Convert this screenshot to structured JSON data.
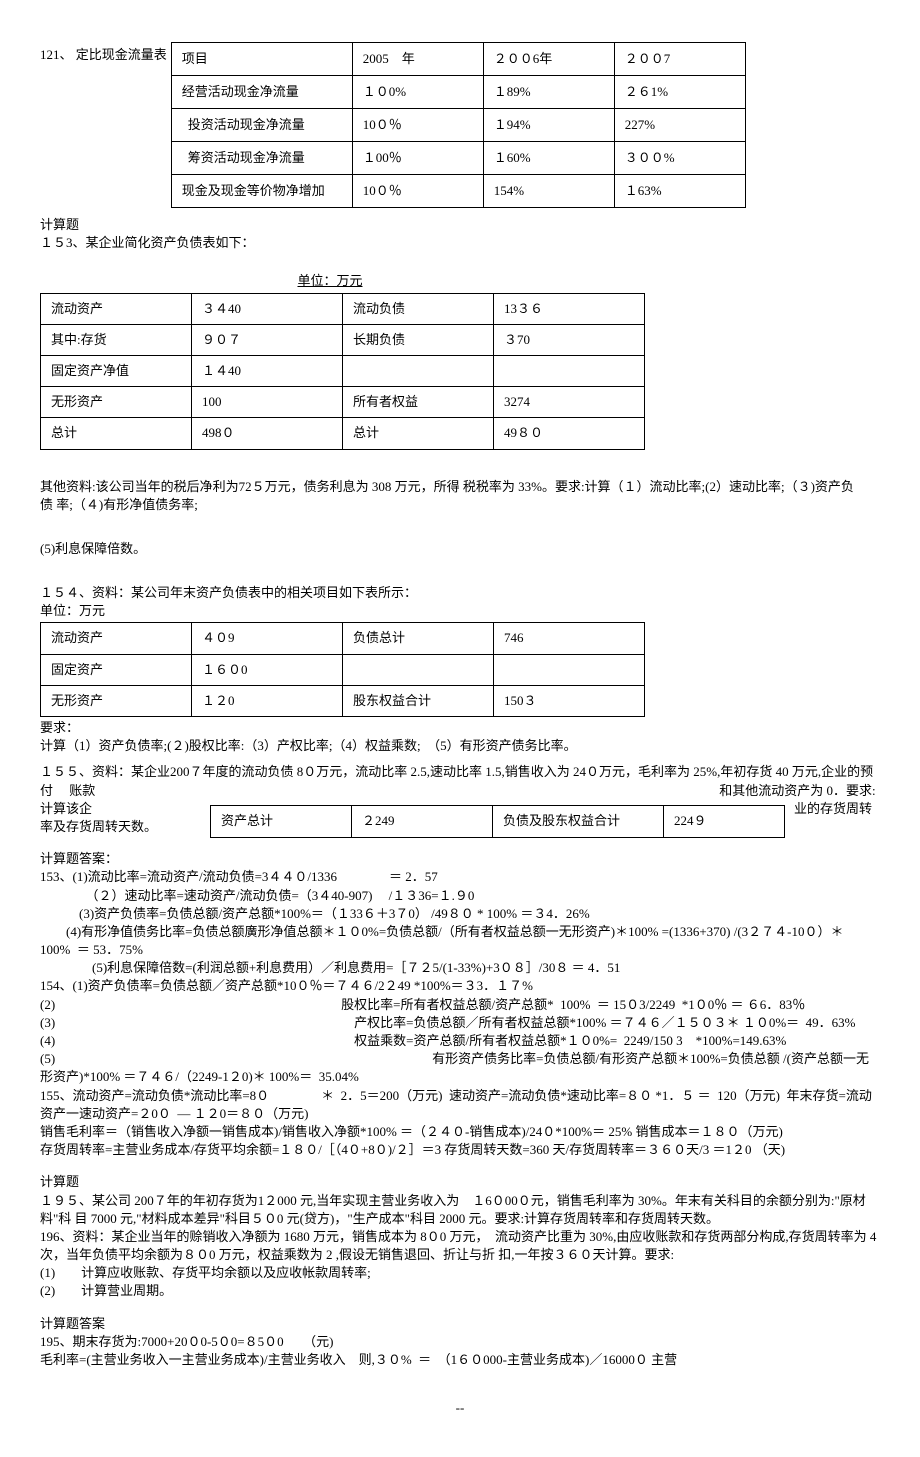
{
  "q121": {
    "heading": "121、 定比现金流量表",
    "table": {
      "headers": [
        "项目",
        "2005　年",
        "２００6年",
        "２００7"
      ],
      "rows": [
        [
          "经营活动现金净流量",
          "１０0%",
          "１89%",
          "２６1%"
        ],
        [
          "投资活动现金净流量",
          "10０％",
          "１94%",
          "227%"
        ],
        [
          "筹资活动现金净流量",
          "１00％",
          "１60%",
          "３００%"
        ],
        [
          "现金及现金等价物净增加",
          "10０％",
          "154%",
          "１63%"
        ]
      ]
    }
  },
  "calc_header": "计算题",
  "q153": {
    "heading": "１５3、某企业简化资产负债表如下：",
    "unit": "单位：万元",
    "table": [
      [
        "流动资产",
        "３４40",
        "流动负债",
        "13３６"
      ],
      [
        "其中:存货",
        "９０７",
        "长期负债",
        "３70"
      ],
      [
        "固定资产净值",
        "１４40",
        "",
        ""
      ],
      [
        "无形资产",
        "100",
        "所有者权益",
        "3274"
      ],
      [
        "总计",
        "498０",
        "总计",
        "49８０"
      ]
    ],
    "other": "其他资料:该公司当年的税后净利为72５万元，债务利息为 308 万元，所得 税税率为 33%。要求:计算（１）流动比率;(2）速动比率;（３)资产负债 率;（４)有形净值债务率;",
    "line5": "(5)利息保障倍数。"
  },
  "q154": {
    "heading": "１５４、资料：某公司年末资产负债表中的相关项目如下表所示：",
    "unit": "单位：万元",
    "table": [
      [
        "流动资产",
        "４０9",
        "负债总计",
        "746"
      ],
      [
        "固定资产",
        "１６０0",
        "",
        ""
      ],
      [
        "无形资产",
        "１２0",
        "股东权益合计",
        "150３"
      ]
    ],
    "req": "要求：",
    "req2": "计算（1）资产负债率;(２)股权比率:（3）产权比率;（4）权益乘数;　（5）有形资产债务比率。"
  },
  "q155": {
    "text_left": "１５５、资料：某企业200７年度的流动负债 8０万元，流动比率 2.5,速动比率 1.5,销售收入为 24０万元，毛利率为 25%,年初存货 40 万元,企业的预付　 账款　　　　　　　　　　　　　　　　　　　　　　　　　　　　　　　　　　　　　　　　　　　　　　　　和其他流动资产为 0．要求:计算该企　　　　　　　　　　　　　　　　　　　　　　　　　　　　　　　　　　　　　　　　　　　　　　　　　　　　　　业的存货周转率及存货周转天数。",
    "table_row": [
      "资产总计",
      "２249",
      "负债及股东权益合计",
      "224９"
    ]
  },
  "answers": {
    "heading": "计算题答案：",
    "a153_1": "153、(1)流动比率=流动资产/流动负债=3４４０/1336　　　　＝ 2．57",
    "a153_2": "　　　　（２）速动比率=速动资产/流动负债=（3４40-907)　 /１３36=１.９0",
    "a153_3": "　　　(3)资产负债率=负债总额/资产总额*100%＝（１33６＋3７0） /49８０ * 100% ＝３4．26%",
    "a153_4": "　　(4)有形净值债务比率=负债总额廣形净值总额＊１０0%=负债总额/（所有者权益总额一无形资产)＊100% =(1336+370) /(3２７４-10０）＊100%  ＝ 53．75%",
    "a153_5": "　　　　(5)利息保障倍数=(利润总额+利息费用）／利息费用=［７２5/(1-33%)+3０８］/30８ ＝ 4．51",
    "a154_1": "154、(1)资产负债率=负债总额／资产总额*10０％＝７４６/2２49 *100%＝３3．１７%",
    "a154_2": "(2)　　　　　　　　　　　　　　　　　　　　　　股权比率=所有者权益总额/资产总额*  100%  ＝ 15０3/2249  *1０0％ ＝ ６6．83％",
    "a154_3": "(3)　　　　　　　　　　　　　　　　　　　　　　　产权比率=负债总额／所有者权益总额*100% ＝７４６／１５０３＊ １０0%＝  49．63%",
    "a154_4": "(4)　　　　　　　　　　　　　　　　　　　　　　　权益乘数=资产总额/所有者权益总额*１０0%=  2249/150 3　*100%=149.63%",
    "a154_5": "(5)　　　　　　　　　　　　　　　　　　　　　　　　　　　　　有形资产债务比率=负债总额/有形资产总额＊100%=负债总额 /(资产总额一无形资产)*100% ＝７４６/（2249-1２0)＊ 100%＝  35.04%",
    "a155_1": "155、流动资产=流动负债*流动比率=8０　　　　＊  2．5＝200（万元)  速动资产=流动负债*速动比率=８０ *1．５ ＝  120（万元)  年末存货=流动资产一速动资产=２0０  — １２0＝８０（万元)",
    "a155_2": "销售毛利率＝（销售收入净额一销售成本)/销售收入净额*100% ＝（２４０-销售成本)/24０*100%＝ 25% 销售成本＝１８０（万元)",
    "a155_3": "存货周转率=主营业务成本/存货平均余额=１８０/［（4０+8０)/２］＝3 存货周转天数=360 天/存货周转率＝３６０天/3 ＝1２0 （天)"
  },
  "calc2_header": "计算题",
  "q195": "１９５、某公司 200７年的年初存货为1２000 元,当年实现主营业务收入为　１6０00０元，销售毛利率为 30%。年末有关科目的余额分别为:\"原材料\"科 目 7000 元,\"材料成本差异\"科目５０0 元(贷方)，\"生产成本\"科目 2000 元。要求:计算存货周转率和存货周转天数。",
  "q196": "196、资料：某企业当年的赊销收入净额为 1680 万元，销售成本为 8０0 万元，  流动资产比重为 30%,由应收账款和存货两部分构成,存货周转率为 4 次，当年负债平均余额为８０0 万元，权益乘数为 2 ,假设无销售退回、折让与折 扣,一年按３６０天计算。要求:",
  "q196_1": "(1)　　计算应收账款、存货平均余额以及应收帐款周转率;",
  "q196_2": "(2)　　计算营业周期。",
  "ans2_header": "计算题答案",
  "a195_1": "195、期末存货为:7000+20０0-5０0=８5０0　　（元)",
  "a195_2": "毛利率=(主营业务收入一主营业务成本)/主营业务收入　则,３０%  ＝  （1６０000-主营业务成本)／16000０ 主营",
  "footer": "--"
}
